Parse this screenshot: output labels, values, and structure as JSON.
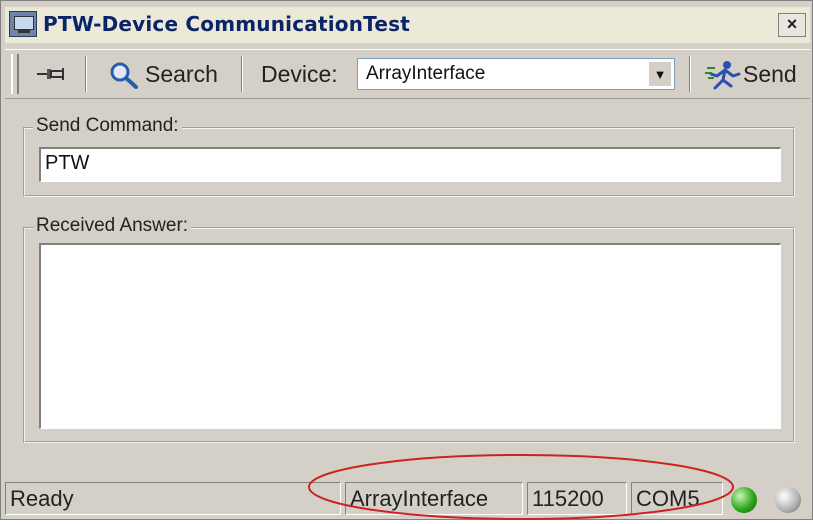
{
  "window": {
    "title": "PTW-Device CommunicationTest",
    "close_label": "×"
  },
  "toolbar": {
    "search_label": "Search",
    "device_label": "Device:",
    "device_value": "ArrayInterface",
    "send_label": "Send"
  },
  "send_command": {
    "group_label": "Send Command:",
    "value": "PTW"
  },
  "received_answer": {
    "group_label": "Received Answer:",
    "value": ""
  },
  "statusbar": {
    "status_text": "Ready",
    "interface": "ArrayInterface",
    "baud_rate": "115200",
    "port": "COM5"
  },
  "icons": {
    "pin": "pin-icon",
    "search": "magnifier-icon",
    "send": "running-man-icon",
    "led_active": "green-led-icon",
    "led_inactive": "gray-led-icon"
  },
  "colors": {
    "title_text": "#0a246a",
    "annotation_ellipse": "#cc2222",
    "led_green": "#2da81e",
    "led_gray": "#b6b6b6"
  }
}
